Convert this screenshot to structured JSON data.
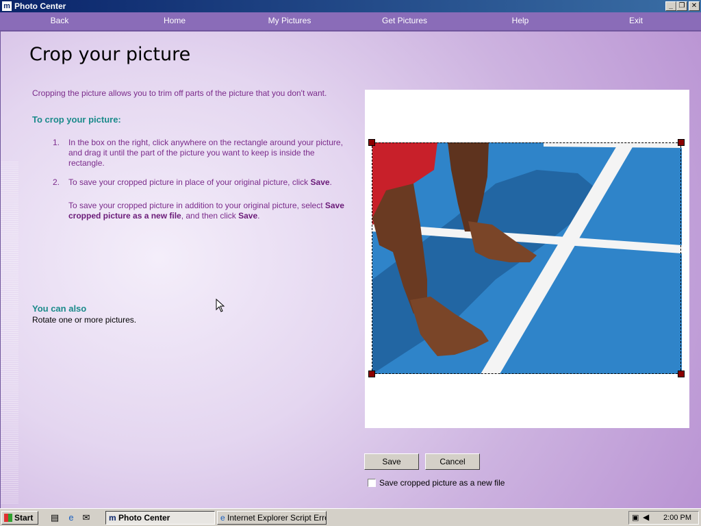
{
  "window": {
    "title": "Photo Center",
    "app_icon": "m",
    "controls": [
      "minimize",
      "restore",
      "close"
    ]
  },
  "nav": {
    "items": [
      "Back",
      "Home",
      "My Pictures",
      "Get Pictures",
      "Help",
      "Exit"
    ]
  },
  "page": {
    "title": "Crop your picture",
    "intro": "Cropping the picture allows you to trim off parts of the picture that you don't want.",
    "instructions_heading": "To crop your picture:",
    "step1_num": "1.",
    "step1_text": "In the box on the right, click anywhere on the rectangle around your picture, and drag it until the part of the picture you want to keep is inside the rectangle.",
    "step2_num": "2.",
    "step2_pre": "To save your cropped picture in place of your original picture, click ",
    "step2_bold": "Save",
    "step2_post": ".",
    "step2_extra_pre": "To save your cropped picture in addition to your original picture, select ",
    "step2_extra_bold1": "Save cropped picture as a new file",
    "step2_extra_mid": ", and then click ",
    "step2_extra_bold2": "Save",
    "step2_extra_post": ".",
    "also_heading": "You can also",
    "also_text": "Rotate one or more pictures."
  },
  "buttons": {
    "save": "Save",
    "cancel": "Cancel"
  },
  "checkbox": {
    "label": "Save cropped picture as a new file",
    "checked": false
  },
  "taskbar": {
    "start": "Start",
    "tasks": [
      "Photo Center",
      "Internet Explorer Script Error"
    ],
    "clock": "2:00 PM"
  },
  "colors": {
    "nav_bg": "#8a6cb8",
    "heading_teal": "#1a8a8a",
    "text_purple": "#7a2a8a",
    "handle": "#8b0000",
    "track_blue": "#2f84c9"
  }
}
